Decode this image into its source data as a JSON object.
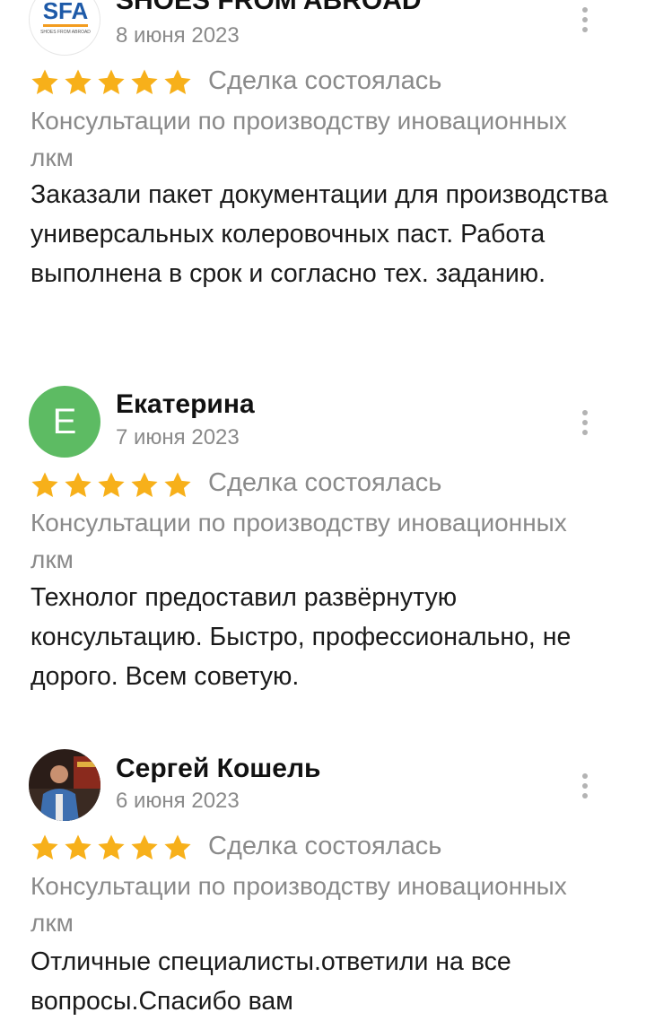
{
  "reviews": [
    {
      "author": "SHOES FROM ABROAD",
      "avatar_type": "logo",
      "logo_text": "SFA",
      "logo_sub": "SHOES FROM ABROAD",
      "date": "8 июня 2023",
      "rating": 5,
      "status": "Сделка состоялась",
      "service": "Консультации по производству иновационных лкм",
      "text": "Заказали пакет документации для производства универсальных колеровочных паст. Работа выполнена в срок и согласно тех. заданию."
    },
    {
      "author": "Екатерина",
      "avatar_type": "letter",
      "avatar_letter": "Е",
      "date": "7 июня 2023",
      "rating": 5,
      "status": "Сделка состоялась",
      "service": "Консультации по производству иновационных лкм",
      "text": "Технолог предоставил развёрнутую консультацию. Быстро, профессионально, не дорого. Всем советую."
    },
    {
      "author": "Сергей Кошель",
      "avatar_type": "photo",
      "date": "6 июня 2023",
      "rating": 5,
      "status": "Сделка состоялась",
      "service": "Консультации по производству иновационных лкм",
      "text": "Отличные специалисты.ответили на все вопросы.Спасибо вам"
    }
  ],
  "colors": {
    "star": "#f7b01a",
    "avatar_green": "#5dbb63",
    "muted_text": "#8a8a8a",
    "logo_blue": "#1e5aa8",
    "logo_orange": "#f39c1f"
  },
  "icons": {
    "rating_star": "star-icon",
    "menu": "more-vertical-icon"
  }
}
